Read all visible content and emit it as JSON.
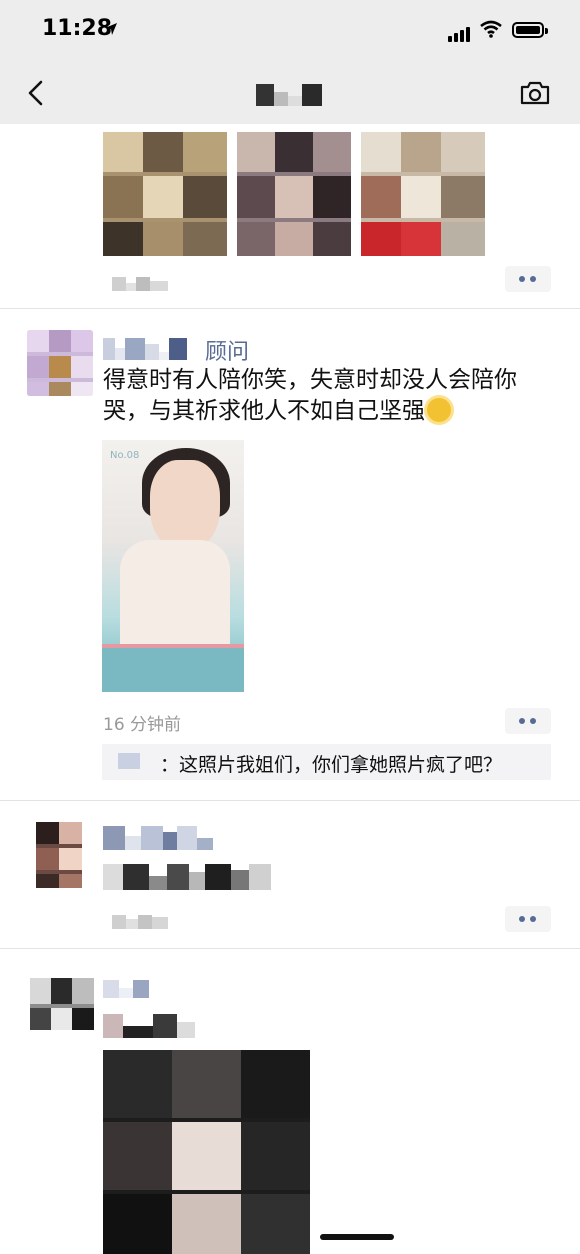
{
  "status_bar": {
    "time": "11:28"
  },
  "nav": {
    "back_icon": "chevron-left-icon",
    "camera_icon": "camera-icon"
  },
  "colors": {
    "nav_bg": "#ededed",
    "link_blue": "#576b95",
    "time_gray": "#999999",
    "comment_bg": "#f3f3f5"
  },
  "moment_2": {
    "nickname_suffix": "顾问",
    "text": "得意时有人陪你笑，失意时却没人会陪你哭，与其祈求他人不如自己坚强",
    "emoji": "sun-emoji",
    "poster": {
      "tag": "No.08"
    },
    "timestamp": "16 分钟前",
    "comment_text": "：这照片我姐们，你们拿她照片疯了吧？"
  }
}
